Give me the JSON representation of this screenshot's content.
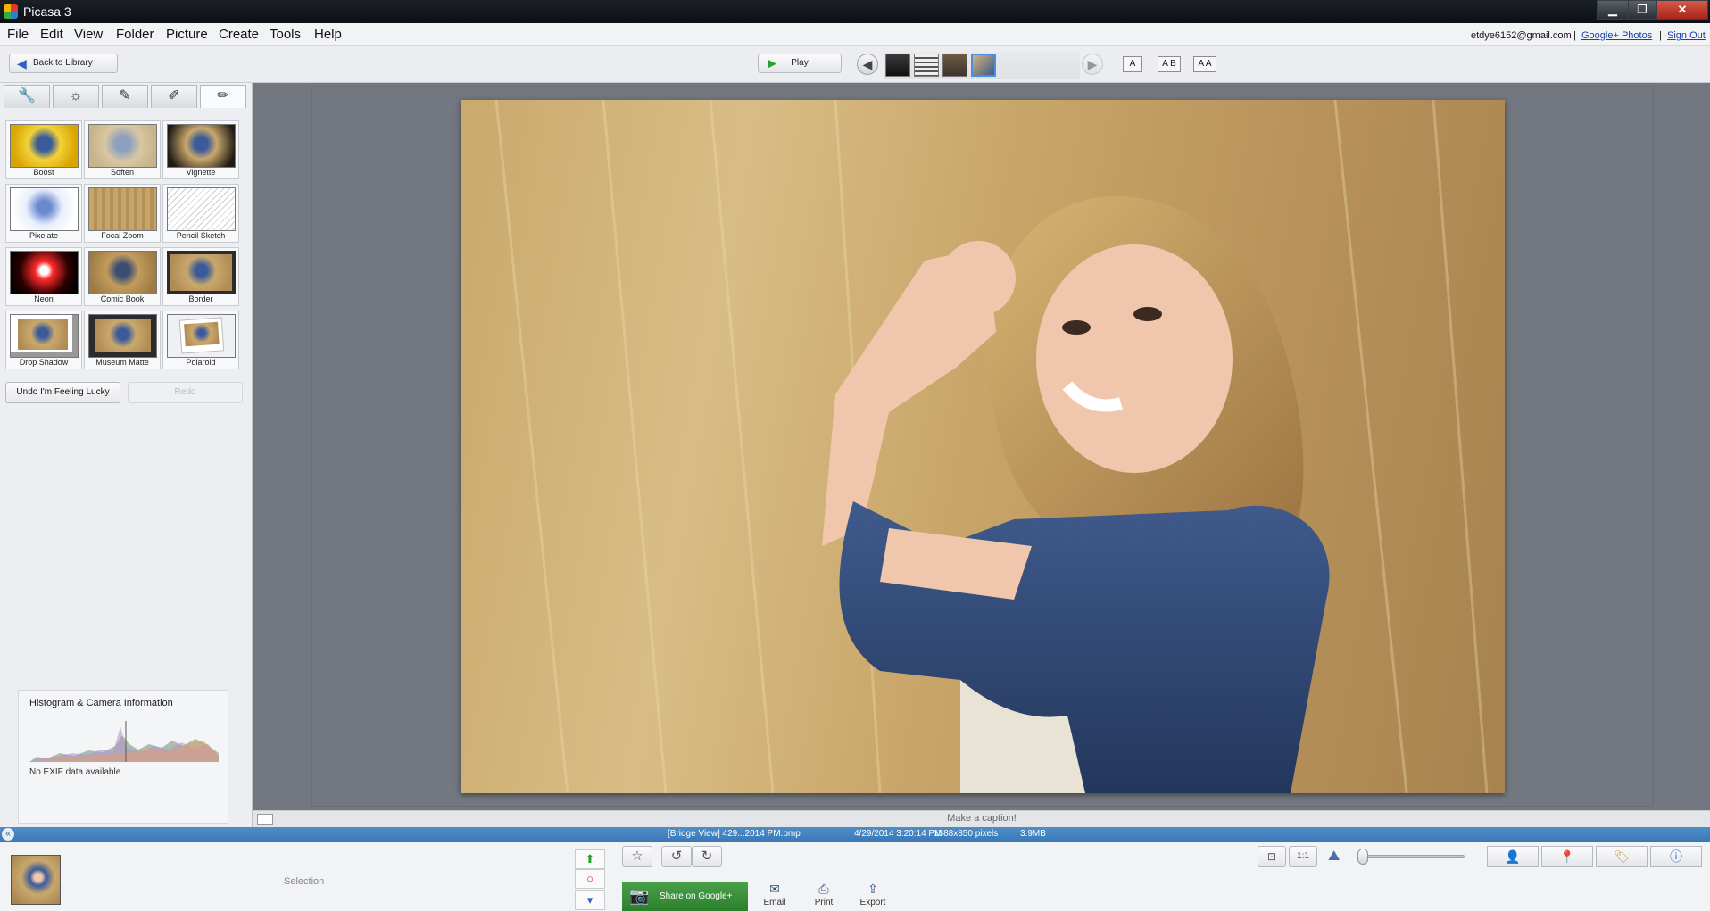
{
  "window": {
    "title": "Picasa 3",
    "min": "▁",
    "max": "❐",
    "close": "✕"
  },
  "menu": [
    "File",
    "Edit",
    "View",
    "Folder",
    "Picture",
    "Create",
    "Tools",
    "Help"
  ],
  "account": {
    "email": "etdye6152@gmail.com",
    "sep": "|",
    "photos_link": "Google+ Photos",
    "signout": "Sign Out"
  },
  "toolbar": {
    "back_label": "Back to Library",
    "play_label": "Play",
    "text_buttons": [
      "A",
      "A B",
      "A A"
    ]
  },
  "panel": {
    "tabs": [
      {
        "icon": "wrench-icon",
        "glyph": "🔧"
      },
      {
        "icon": "sun-icon",
        "glyph": "☼"
      },
      {
        "icon": "brush-icon",
        "glyph": "✎"
      },
      {
        "icon": "pencil-green-icon",
        "glyph": "✐"
      },
      {
        "icon": "pencil-blue-icon",
        "glyph": "✏"
      }
    ],
    "effects": [
      "Boost",
      "Soften",
      "Vignette",
      "Pixelate",
      "Focal Zoom",
      "Pencil Sketch",
      "Neon",
      "Comic Book",
      "Border",
      "Drop Shadow",
      "Museum Matte",
      "Polaroid"
    ],
    "undo_label": "Undo I'm Feeling Lucky",
    "redo_label": "Redo"
  },
  "histogram": {
    "title": "Histogram & Camera Information",
    "exif": "No EXIF data available."
  },
  "caption": {
    "placeholder": "Make a caption!"
  },
  "status": {
    "file": "[Bridge View] 429...2014 PM.bmp",
    "date": "4/29/2014 3:20:14 PM",
    "dims": "1588x850 pixels",
    "size": "3.9MB"
  },
  "tray": {
    "selection_label": "Selection",
    "share_label": "Share on Google+",
    "actions": [
      {
        "label": "Email",
        "icon": "email-icon",
        "glyph": "✉"
      },
      {
        "label": "Print",
        "icon": "print-icon",
        "glyph": "⎙"
      },
      {
        "label": "Export",
        "icon": "export-icon",
        "glyph": "⇪"
      }
    ]
  },
  "colors": {
    "status_blue": "#3a78b5",
    "share_green": "#2c7f2c",
    "canvas_gray": "#727780"
  }
}
